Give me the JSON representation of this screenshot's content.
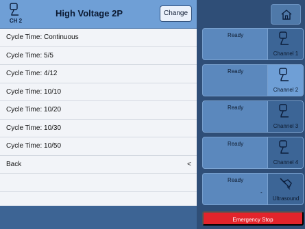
{
  "header": {
    "channel_label": "CH 2",
    "title": "High Voltage 2P",
    "change_label": "Change"
  },
  "list": {
    "items": [
      {
        "label": "Cycle Time: Continuous"
      },
      {
        "label": "Cycle Time: 5/5"
      },
      {
        "label": "Cycle Time: 4/12"
      },
      {
        "label": "Cycle Time: 10/10"
      },
      {
        "label": "Cycle Time: 10/20"
      },
      {
        "label": "Cycle Time: 10/30"
      },
      {
        "label": "Cycle Time: 10/50"
      },
      {
        "label": "Back",
        "chevron": "<"
      },
      {
        "label": ""
      }
    ]
  },
  "channels": [
    {
      "status": "Ready",
      "name": "Channel 1",
      "icon": "electrode-icon"
    },
    {
      "status": "Ready",
      "name": "Channel 2",
      "icon": "electrode-icon"
    },
    {
      "status": "Ready",
      "name": "Channel 3",
      "icon": "electrode-icon"
    },
    {
      "status": "Ready",
      "name": "Channel 4",
      "icon": "electrode-icon"
    },
    {
      "status": "Ready",
      "dash": "-",
      "name": "Ultrasound",
      "icon": "ultrasound-probe-icon"
    }
  ],
  "emergency_stop_label": "Emergency Stop",
  "colors": {
    "header": "#6f9fd6",
    "panel": "#2f4e77",
    "card": "#5b88bd",
    "emergency": "#e3242b"
  }
}
